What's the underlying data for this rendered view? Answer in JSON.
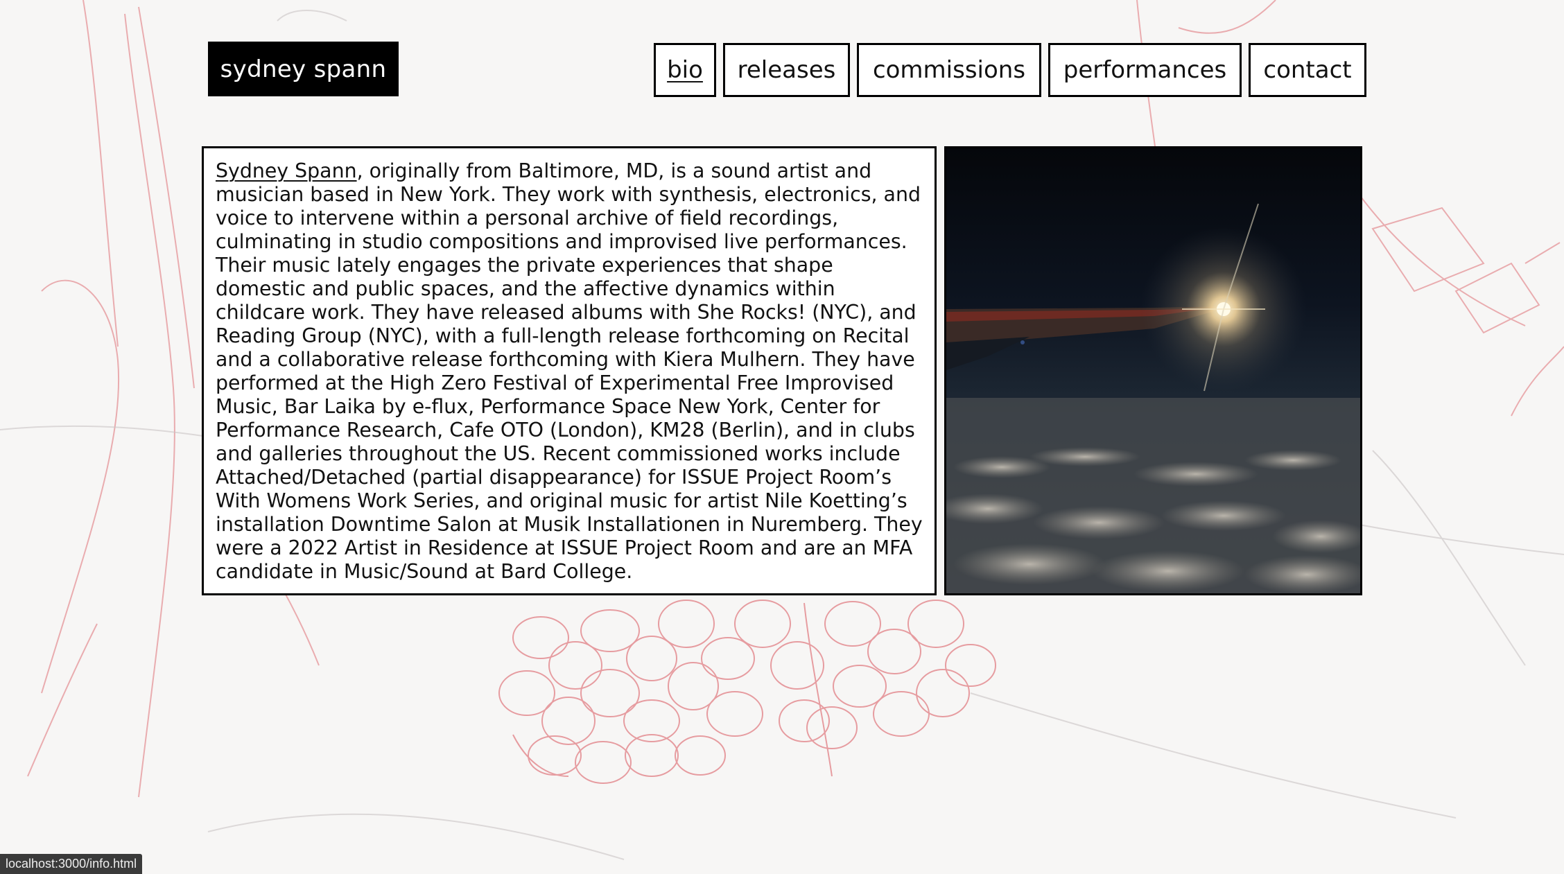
{
  "site": {
    "logo": "sydney spann"
  },
  "nav": {
    "items": [
      {
        "label": "bio",
        "active": true
      },
      {
        "label": "releases",
        "active": false
      },
      {
        "label": "commissions",
        "active": false
      },
      {
        "label": "performances",
        "active": false
      },
      {
        "label": "contact",
        "active": false
      }
    ]
  },
  "bio": {
    "name_link": "Sydney Spann",
    "text": ", originally from Baltimore, MD, is a sound artist and musician based in New York. They work with synthesis, electronics, and voice to intervene within a personal archive of field recordings, culminating in studio compositions and improvised live performances. Their music lately engages the private experiences that shape domestic and public spaces, and the affective dynamics within childcare work. They have released albums with She Rocks! (NYC), and Reading Group (NYC), with a full-length release forthcoming on Recital and a collaborative release forthcoming with Kiera Mulhern. They have performed at the High Zero Festival of Experimental Free Improvised Music, Bar Laika by e-flux, Performance Space New York, Center for Performance Research, Cafe OTO (London), KM28 (Berlin), and in clubs and galleries throughout the US. Recent commissioned works include Attached/Detached (partial disappearance) for ISSUE Project Room’s With Womens Work Series, and original music for artist Nile Koetting’s installation Downtime Salon at Musik Installationen in Nuremberg. They were a 2022 Artist in Residence at ISSUE Project Room and are an MFA candidate in Music/Sound at Bard College."
  },
  "photo": {
    "icon": "night-airplane-wing-photo"
  },
  "status": {
    "url": "localhost:3000/info.html"
  },
  "colors": {
    "background": "#f7f6f5",
    "sketch_red": "#d9535b",
    "sketch_grey": "#c9c4c4",
    "logo_bg": "#000000",
    "logo_text": "#ffffff"
  }
}
